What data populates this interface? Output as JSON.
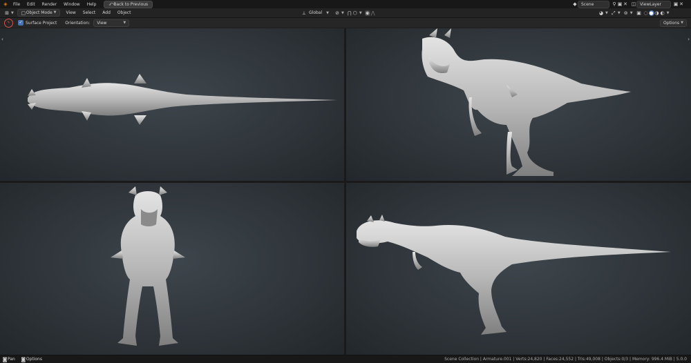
{
  "topbar": {
    "menus": [
      "File",
      "Edit",
      "Render",
      "Window",
      "Help"
    ],
    "back_button": "Back to Previous",
    "scene_label": "Scene",
    "view_layer_label": "ViewLayer"
  },
  "header": {
    "mode_label": "Object Mode",
    "menus": [
      "View",
      "Select",
      "Add",
      "Object"
    ],
    "transform_orientation": "Global"
  },
  "tool_options": {
    "surface_project_label": "Surface Project",
    "surface_project_checked": true,
    "orientation_label": "Orientation:",
    "orientation_value": "View",
    "options_label": "Options"
  },
  "statusbar": {
    "pan_label": "Pan",
    "options_label": "Options",
    "stats": "Scene Collection | Armature.001 | Verts:24,820 | Faces:24,552 | Tris:49,008 | Objects:0/3 | Memory: 996.4 MiB | 5.0.0"
  },
  "icons": {
    "blender_logo": "blender-logo-icon",
    "pin": "pin-icon",
    "snap": "magnet-icon",
    "shading": "sphere-icon"
  },
  "colors": {
    "accent": "#4772b3",
    "background": "#1d1d1d",
    "viewport": "#353c42",
    "clay": "#b9b9b9"
  }
}
